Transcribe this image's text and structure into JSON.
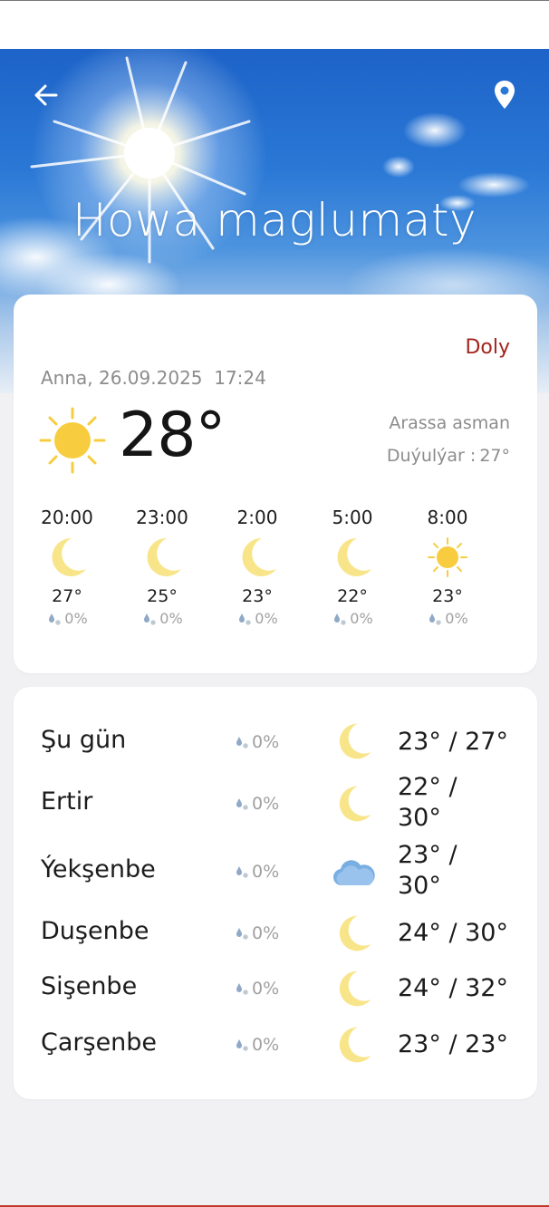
{
  "hero": {
    "title": "Howa maglumaty",
    "back_icon": "arrow-left-icon",
    "location_icon": "location-pin-icon"
  },
  "current": {
    "more_label": "Doly",
    "day_date": "Anna, 26.09.2025",
    "time": "17:24",
    "icon": "sun-icon",
    "temperature": "28°",
    "description": "Arassa asman",
    "feels_label": "Duýulýar :",
    "feels_value": "27°"
  },
  "hourly": [
    {
      "time": "20:00",
      "icon": "moon-icon",
      "temp": "27°",
      "precip": "0%"
    },
    {
      "time": "23:00",
      "icon": "moon-icon",
      "temp": "25°",
      "precip": "0%"
    },
    {
      "time": "2:00",
      "icon": "moon-icon",
      "temp": "23°",
      "precip": "0%"
    },
    {
      "time": "5:00",
      "icon": "moon-icon",
      "temp": "22°",
      "precip": "0%"
    },
    {
      "time": "8:00",
      "icon": "sun-icon",
      "temp": "23°",
      "precip": "0%"
    }
  ],
  "daily": [
    {
      "name": "Şu gün",
      "precip": "0%",
      "icon": "moon-icon",
      "temps": "23° / 27°"
    },
    {
      "name": "Ertir",
      "precip": "0%",
      "icon": "moon-icon",
      "temps": "22° / 30°"
    },
    {
      "name": "Ýekşenbe",
      "precip": "0%",
      "icon": "cloud-icon",
      "temps": "23° / 30°"
    },
    {
      "name": "Duşenbe",
      "precip": "0%",
      "icon": "moon-icon",
      "temps": "24° / 30°"
    },
    {
      "name": "Sişenbe",
      "precip": "0%",
      "icon": "moon-icon",
      "temps": "24° / 32°"
    },
    {
      "name": "Çarşenbe",
      "precip": "0%",
      "icon": "moon-icon",
      "temps": "23° / 23°"
    }
  ],
  "colors": {
    "accent": "#a3241d",
    "sun": "#f7cd3f",
    "moon": "#f8e58a",
    "cloud": "#79aee3"
  }
}
